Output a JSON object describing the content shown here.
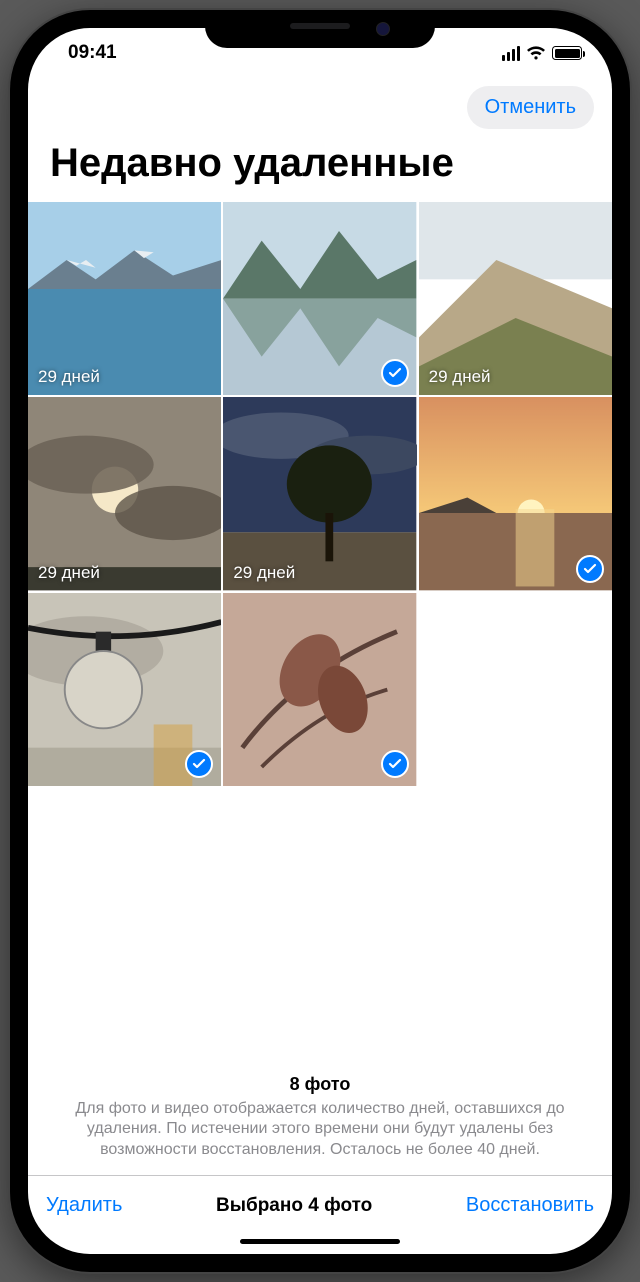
{
  "status": {
    "time": "09:41"
  },
  "nav": {
    "cancel": "Отменить"
  },
  "title": "Недавно удаленные",
  "photos": [
    {
      "days": "29 дней",
      "selected": false
    },
    {
      "days": "",
      "selected": true
    },
    {
      "days": "29 дней",
      "selected": false
    },
    {
      "days": "29 дней",
      "selected": false
    },
    {
      "days": "29 дней",
      "selected": false
    },
    {
      "days": "",
      "selected": true
    },
    {
      "days": "",
      "selected": true
    },
    {
      "days": "",
      "selected": true
    }
  ],
  "summary": {
    "count": "8 фото",
    "note": "Для фото и видео отображается количество дней, оставшихся до удаления. По истечении этого времени они будут удалены без возможности восстановления. Осталось не более 40 дней."
  },
  "toolbar": {
    "delete": "Удалить",
    "selected": "Выбрано 4 фото",
    "recover": "Восстановить"
  }
}
